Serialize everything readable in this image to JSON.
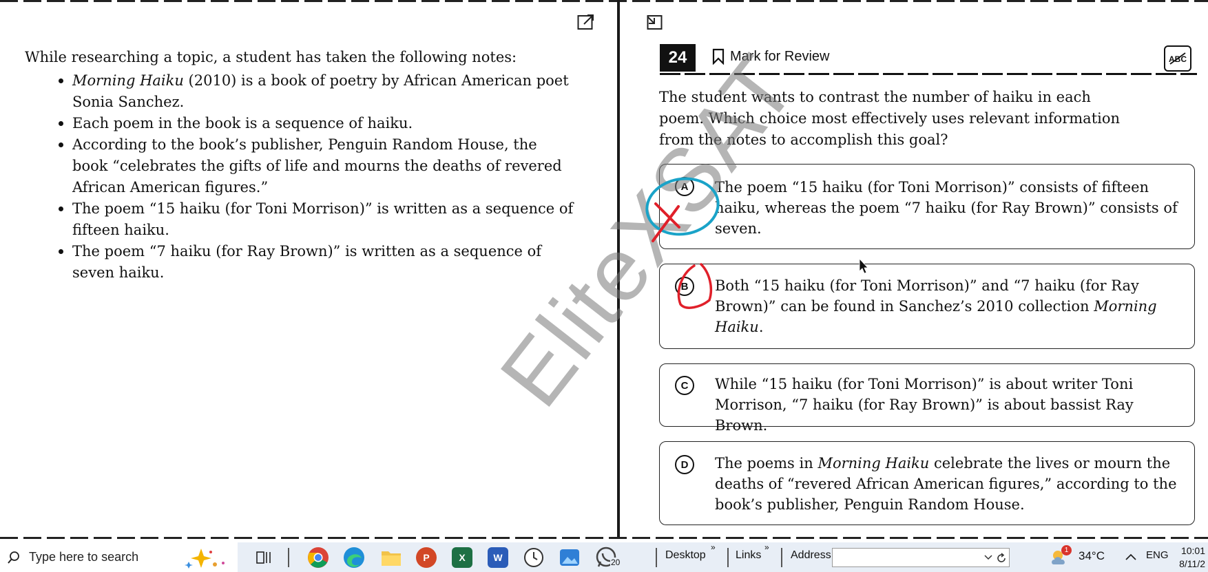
{
  "passage": {
    "intro": "While researching a topic, a student has taken the following notes:",
    "notes": [
      {
        "italic": "Morning Haiku",
        "rest": " (2010) is a book of poetry by African American poet Sonia Sanchez."
      },
      {
        "italic": "",
        "rest": "Each poem in the book is a sequence of haiku."
      },
      {
        "italic": "",
        "rest": "According to the book’s publisher, Penguin Random House, the book “celebrates the gifts of life and mourns the deaths of revered African American figures.”"
      },
      {
        "italic": "",
        "rest": "The poem “15 haiku (for Toni Morrison)” is written as a sequence of fifteen haiku."
      },
      {
        "italic": "",
        "rest": "The poem “7 haiku (for Ray Brown)” is written as a sequence of seven haiku."
      }
    ]
  },
  "question": {
    "number": "24",
    "mark_for_review": "Mark for Review",
    "abc_label": "ABC",
    "prompt": "The student wants to contrast the number of haiku in each poem. Which choice most effectively uses relevant information from the notes to accomplish this goal?",
    "choices": [
      {
        "letter": "A",
        "pre": "The poem “15 haiku (for Toni Morrison)” consists of fifteen haiku, whereas the poem “7 haiku (for Ray Brown)” consists of seven.",
        "italic": "",
        "post": ""
      },
      {
        "letter": "B",
        "pre": "Both “15 haiku (for Toni Morrison)” and “7 haiku (for Ray Brown)” can be found in Sanchez’s 2010 collection ",
        "italic": "Morning Haiku",
        "post": "."
      },
      {
        "letter": "C",
        "pre": "While “15 haiku (for Toni Morrison)” is about writer Toni Morrison, “7 haiku (for Ray Brown)” is about bassist Ray Brown.",
        "italic": "",
        "post": ""
      },
      {
        "letter": "D",
        "pre": "The poems in ",
        "italic": "Morning Haiku",
        "post": " celebrate the lives or mourn the deaths of “revered African American figures,” according to the book’s publisher, Penguin Random House."
      }
    ]
  },
  "watermark": "EliteXSAT",
  "annotation_colors": {
    "circle": "#1aa3c8",
    "x_mark": "#e0202a",
    "b_mark": "#e0202a"
  },
  "taskbar": {
    "search_placeholder": "Type here to search",
    "whatsapp_badge": "20",
    "toolbar_desktop": "Desktop",
    "toolbar_links": "Links",
    "toolbar_address": "Address",
    "chevron_glyph": "»",
    "weather_temp": "34°C",
    "weather_alert_badge": "1",
    "language": "ENG",
    "time": "10:01",
    "date": "8/11/2"
  }
}
